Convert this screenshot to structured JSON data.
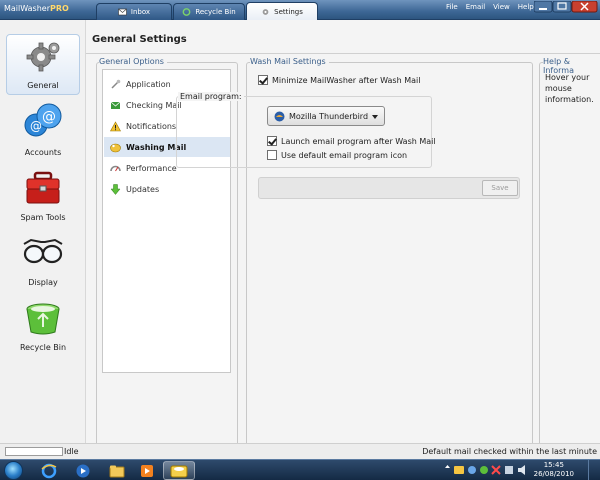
{
  "app": {
    "title_main": "MailWasher",
    "title_suffix": "PRO"
  },
  "tabs": [
    {
      "label": "Inbox",
      "icon": "envelope-icon",
      "active": false
    },
    {
      "label": "Recycle Bin",
      "icon": "recycle-icon",
      "active": false
    },
    {
      "label": "Settings",
      "icon": "gear-icon",
      "active": true
    }
  ],
  "menu": [
    "File",
    "Email",
    "View",
    "Help"
  ],
  "sidebar": {
    "items": [
      {
        "label": "General",
        "icon": "gears-icon",
        "active": true
      },
      {
        "label": "Accounts",
        "icon": "at-sign-icon",
        "active": false
      },
      {
        "label": "Spam Tools",
        "icon": "toolbox-icon",
        "active": false
      },
      {
        "label": "Display",
        "icon": "glasses-icon",
        "active": false
      },
      {
        "label": "Recycle Bin",
        "icon": "recycle-bin-icon",
        "active": false
      }
    ]
  },
  "page": {
    "title": "General Settings"
  },
  "general_options": {
    "label": "General Options",
    "items": [
      {
        "label": "Application",
        "icon": "application-icon"
      },
      {
        "label": "Checking Mail",
        "icon": "checking-mail-icon"
      },
      {
        "label": "Notifications",
        "icon": "warning-icon"
      },
      {
        "label": "Washing Mail",
        "icon": "washing-mail-icon",
        "active": true
      },
      {
        "label": "Performance",
        "icon": "performance-icon"
      },
      {
        "label": "Updates",
        "icon": "down-arrow-icon"
      }
    ]
  },
  "wash_settings": {
    "label": "Wash Mail Settings",
    "minimize_label": "Minimize MailWasher after Wash Mail",
    "minimize_checked": true,
    "email_program_label": "Email program:",
    "email_program_value": "Mozilla Thunderbird",
    "launch_label": "Launch email program after Wash Mail",
    "launch_checked": true,
    "default_icon_label": "Use default email program icon",
    "default_icon_checked": false,
    "save_label": "Save"
  },
  "help": {
    "label": "Help & Informa",
    "text": "Hover your mouse information."
  },
  "status": {
    "left": "Idle",
    "right": "Default mail checked within the last minute"
  },
  "taskbar": {
    "time": "15:45",
    "date": "26/08/2010"
  }
}
